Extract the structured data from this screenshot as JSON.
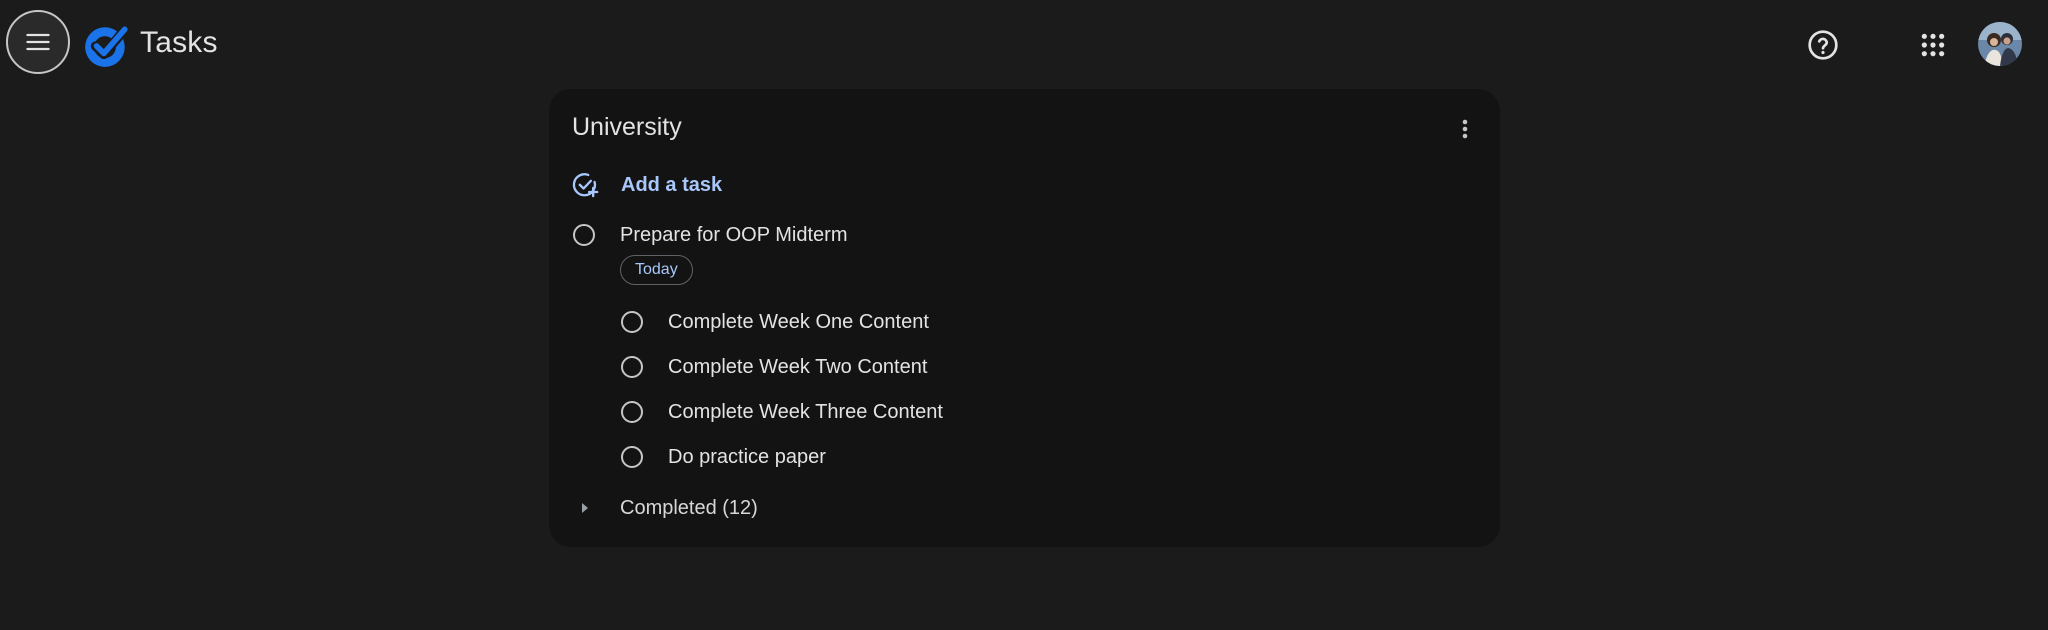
{
  "app": {
    "title": "Tasks"
  },
  "list": {
    "title": "University",
    "add_task_label": "Add a task",
    "tasks": [
      {
        "title": "Prepare for OOP Midterm",
        "due_chip": "Today",
        "subtasks": [
          "Complete Week One Content",
          "Complete Week Two Content",
          "Complete Week Three Content",
          "Do practice paper"
        ]
      }
    ],
    "completed_label": "Completed (12)"
  },
  "icons": {
    "menu": "menu-icon",
    "logo": "tasks-logo-icon",
    "help": "help-icon",
    "apps": "apps-grid-icon",
    "more": "more-vert-icon",
    "add_task": "add-task-icon",
    "expand": "chevron-right-icon"
  },
  "colors": {
    "background": "#1b1b1b",
    "card": "#131313",
    "accent": "#a8c7fa",
    "brand_blue": "#1a73e8",
    "text": "#e3e3e3"
  }
}
